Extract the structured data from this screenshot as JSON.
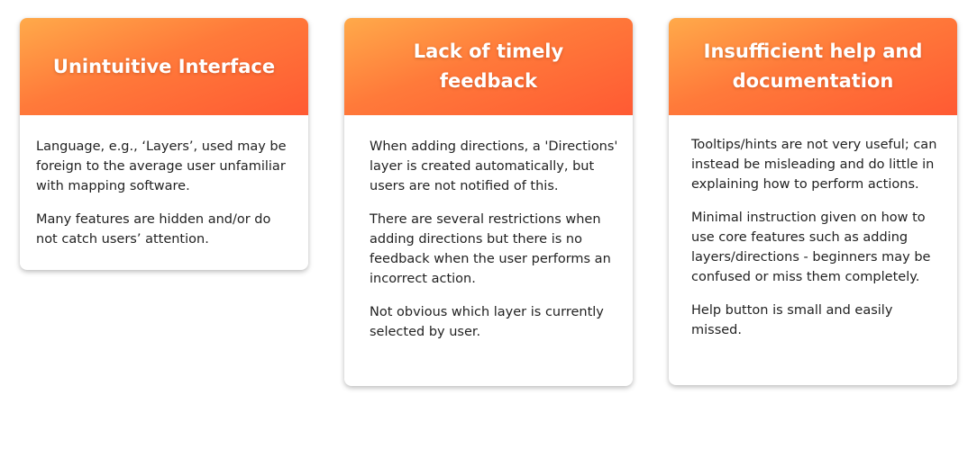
{
  "cards": [
    {
      "title": "Unintuitive Interface",
      "paragraphs": [
        "Language, e.g., ‘Layers’, used may be foreign to the average user unfamiliar with mapping software.",
        "Many features are hidden and/or do not catch users’ attention."
      ]
    },
    {
      "title": "Lack of timely feedback",
      "paragraphs": [
        "When adding directions, a 'Directions' layer is created automatically, but users are not notified of this.",
        "There are several restrictions when adding directions but there is no feedback when the user performs an incorrect action.",
        "Not obvious which layer is currently selected by user."
      ]
    },
    {
      "title": "Insufficient help and documentation",
      "paragraphs": [
        "Tooltips/hints are not very useful; can instead be misleading and do little in explaining how to perform actions.",
        "Minimal instruction given on how to use core features such as adding layers/directions - beginners may be confused or miss them completely.",
        "Help button is small and easily missed."
      ]
    }
  ],
  "colors": {
    "header_gradient_start": "#ffaa4a",
    "header_gradient_end": "#ff5a33",
    "title_text": "#ffffff",
    "body_text": "#222222"
  }
}
